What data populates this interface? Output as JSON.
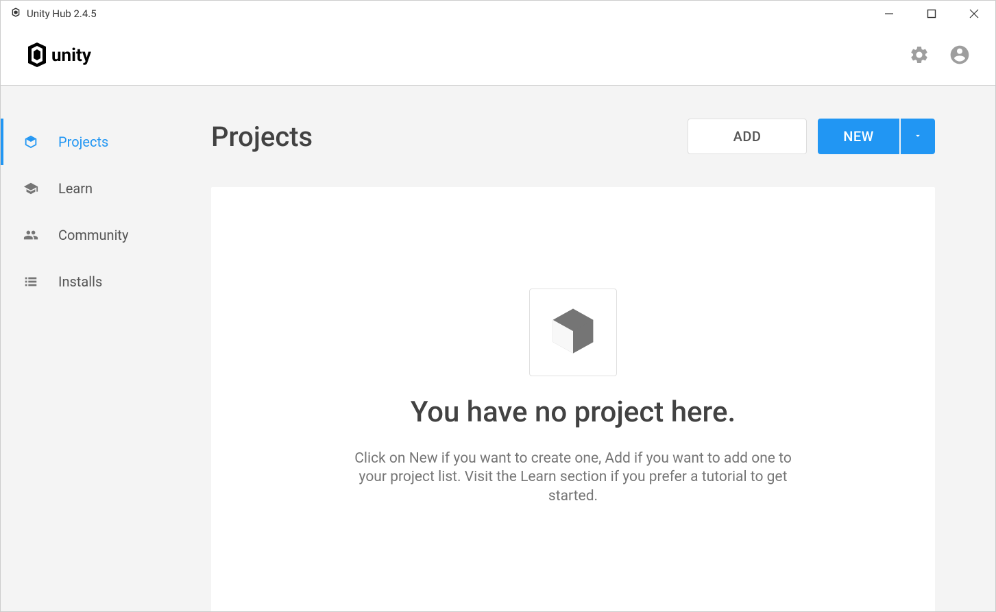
{
  "titlebar": {
    "title": "Unity Hub 2.4.5"
  },
  "header": {
    "brand": "unity"
  },
  "sidebar": {
    "items": [
      {
        "label": "Projects"
      },
      {
        "label": "Learn"
      },
      {
        "label": "Community"
      },
      {
        "label": "Installs"
      }
    ]
  },
  "main": {
    "title": "Projects",
    "add_label": "ADD",
    "new_label": "NEW",
    "empty": {
      "heading": "You have no project here.",
      "description": "Click on New if you want to create one, Add if you want to add one to your project list. Visit the Learn section if you prefer a tutorial to get started."
    }
  }
}
